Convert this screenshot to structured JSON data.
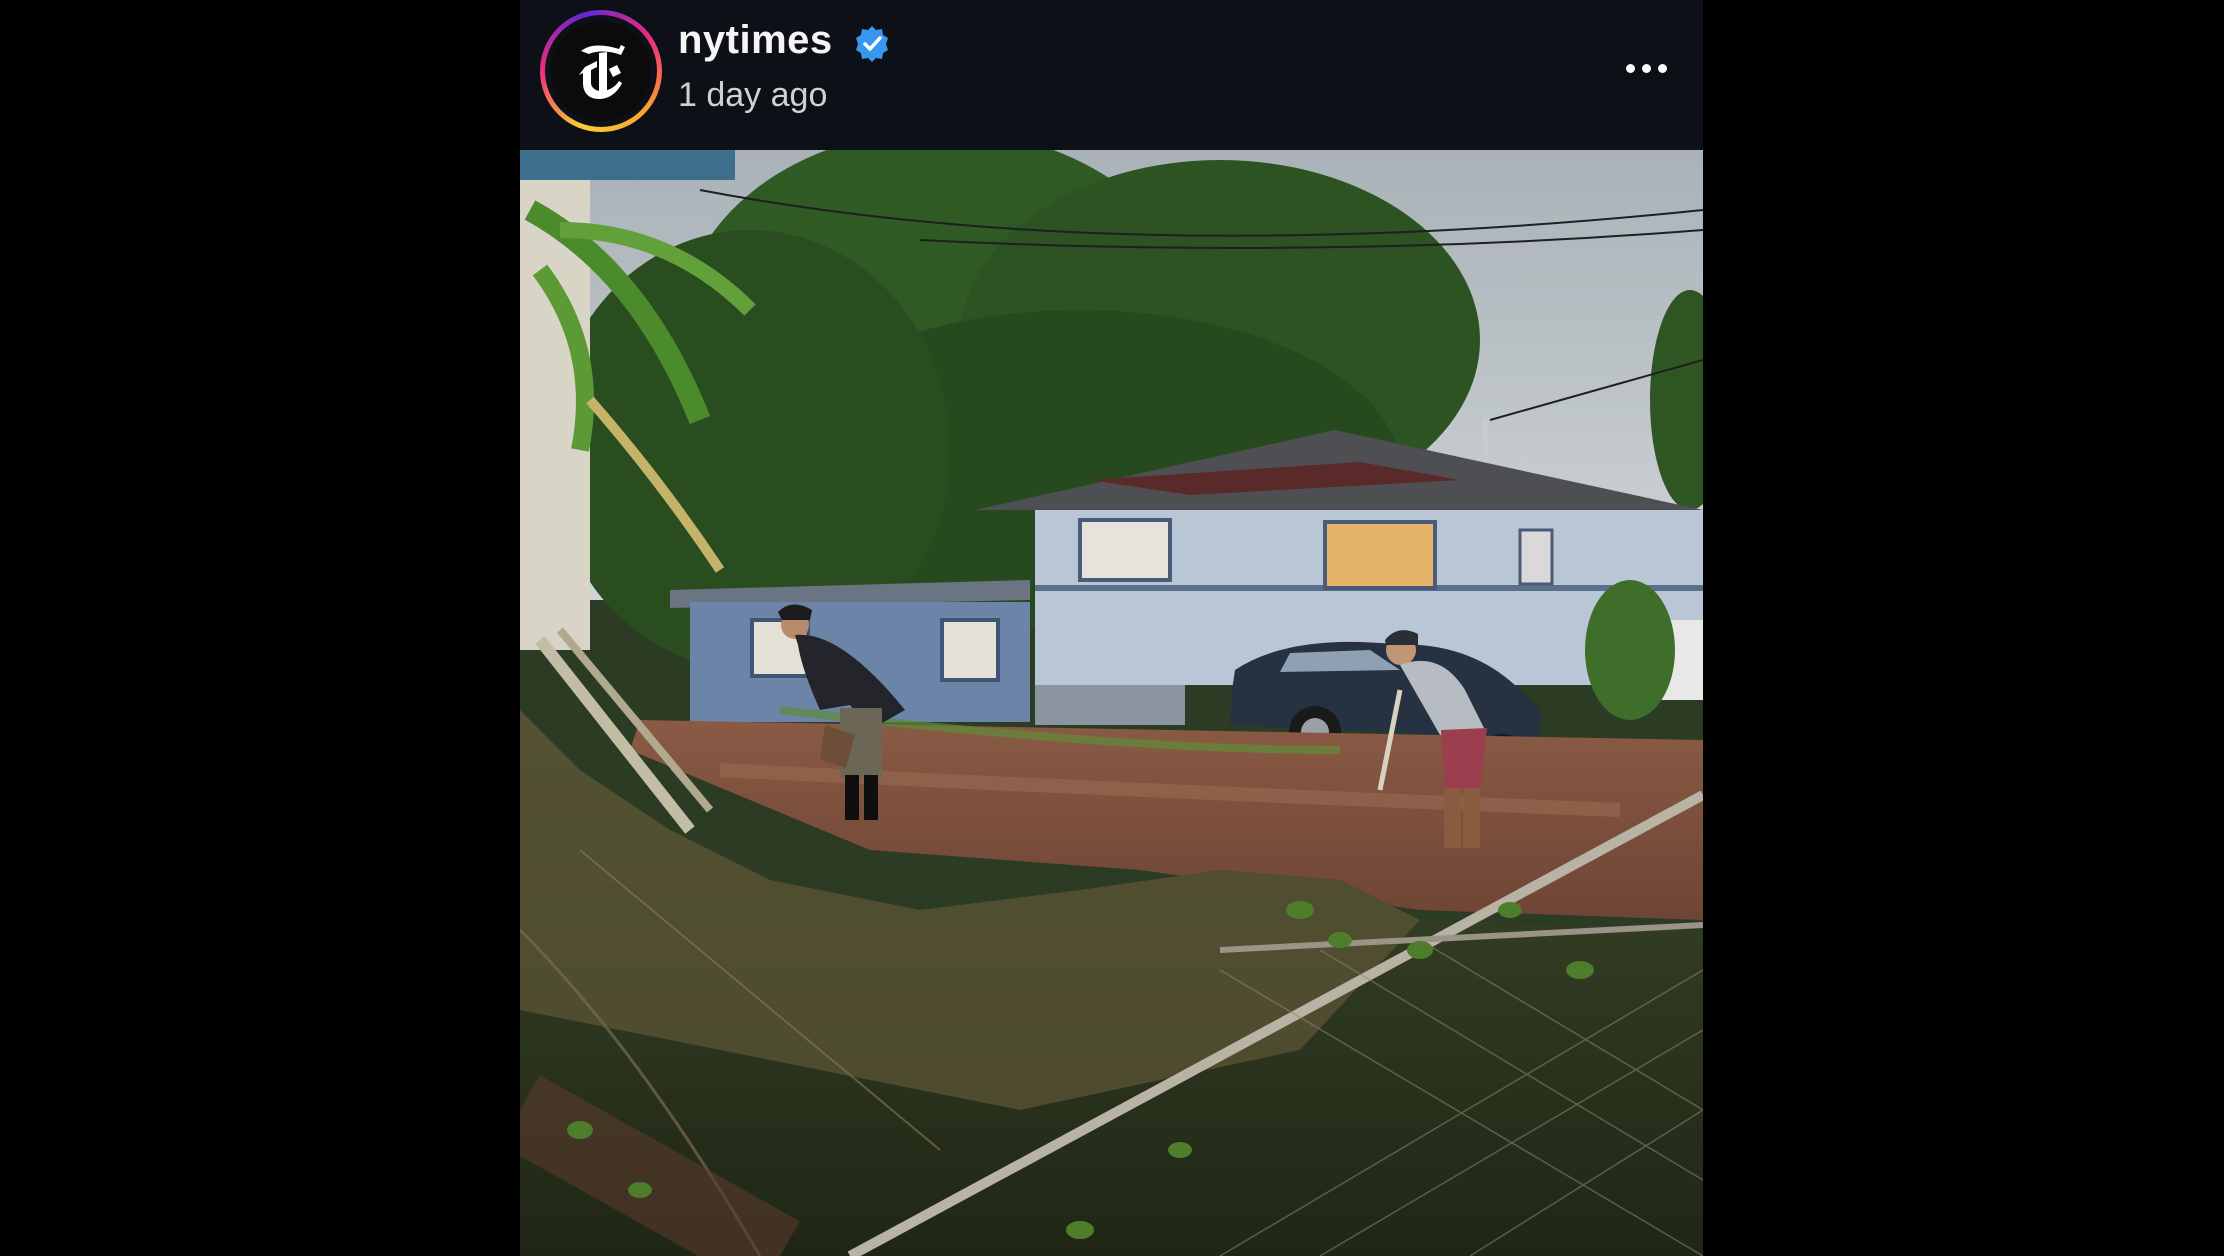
{
  "post": {
    "username": "nytimes",
    "verified": true,
    "timestamp": "1 day ago",
    "avatar_icon": "nyt-logo-icon",
    "verified_icon": "verified-badge-icon",
    "more_icon": "more-options-icon",
    "photo_subject": "photo"
  },
  "colors": {
    "background": "#000000",
    "header": "#0d1117",
    "verified_blue": "#3897f0",
    "ring_gradient": [
      "#f9ce34",
      "#ee2a7b",
      "#6228d7"
    ]
  }
}
